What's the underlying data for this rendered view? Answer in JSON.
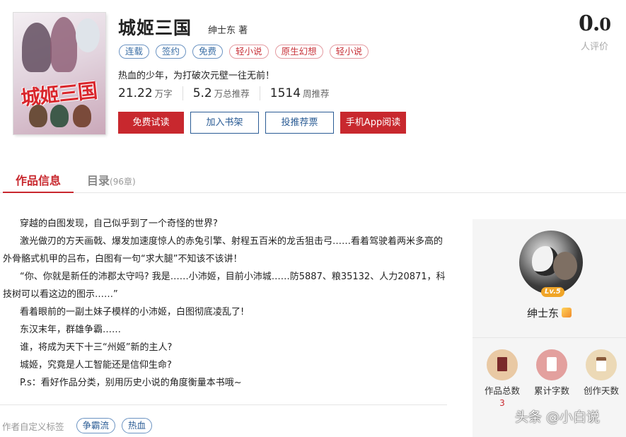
{
  "book": {
    "title": "城姬三国",
    "author_line": "绅士东 著",
    "cover_text": "城姬三国",
    "tags": [
      {
        "label": "连载",
        "tone": "blue"
      },
      {
        "label": "签约",
        "tone": "blue"
      },
      {
        "label": "免费",
        "tone": "blue"
      },
      {
        "label": "轻小说",
        "tone": "red"
      },
      {
        "label": "原生幻想",
        "tone": "red"
      },
      {
        "label": "轻小说",
        "tone": "red"
      }
    ],
    "intro": "热血的少年，为打破次元壁一往无前！",
    "stats": [
      {
        "num": "21.22",
        "unit": "万字"
      },
      {
        "num": "5.2",
        "unit": "万总推荐"
      },
      {
        "num": "1514",
        "unit": "周推荐"
      }
    ],
    "rating": {
      "score_int": "0.",
      "score_dec": "0",
      "count_label": "人评价"
    }
  },
  "buttons": {
    "free_read": "免费试读",
    "add_shelf": "加入书架",
    "vote": "投推荐票",
    "app_read": "手机App阅读"
  },
  "tabs": {
    "info": "作品信息",
    "catalog": "目录",
    "catalog_count": "(96章)"
  },
  "description": [
    "穿越的白图发现，自己似乎到了一个奇怪的世界?",
    "激光做刃的方天画戟、爆发加速度惊人的赤兔引擎、射程五百米的龙舌狙击弓……看着驾驶着两米多高的外骨骼式机甲的吕布，白图有一句“求大腿”不知该不该讲！",
    "“你、你就是新任的沛郡太守吗? 我是……小沛姬，目前小沛城……防5887、粮35132、人力20871，科技树可以看这边的图示……”",
    "看着眼前的一副土妹子模样的小沛姬，白图彻底凌乱了!",
    "东汉末年，群雄争霸……",
    "谁，将成为天下十三“州姬”新的主人?",
    "城姬，究竟是人工智能还是信仰生命?",
    "P.s：看好作品分类，别用历史小说的角度衡量本书哦~"
  ],
  "custom_tags": {
    "label": "作者自定义标签",
    "items": [
      "争霸流",
      "热血"
    ]
  },
  "author_panel": {
    "level": "Lv.5",
    "name": "绅士东",
    "stats": [
      {
        "label": "作品总数",
        "value": "3",
        "color": "#e9c9a4"
      },
      {
        "label": "累计字数",
        "value": "",
        "color": "#e3a09e"
      },
      {
        "label": "创作天数",
        "value": "",
        "color": "#ecd9b6"
      }
    ]
  },
  "watermark": "头条 @小白说"
}
